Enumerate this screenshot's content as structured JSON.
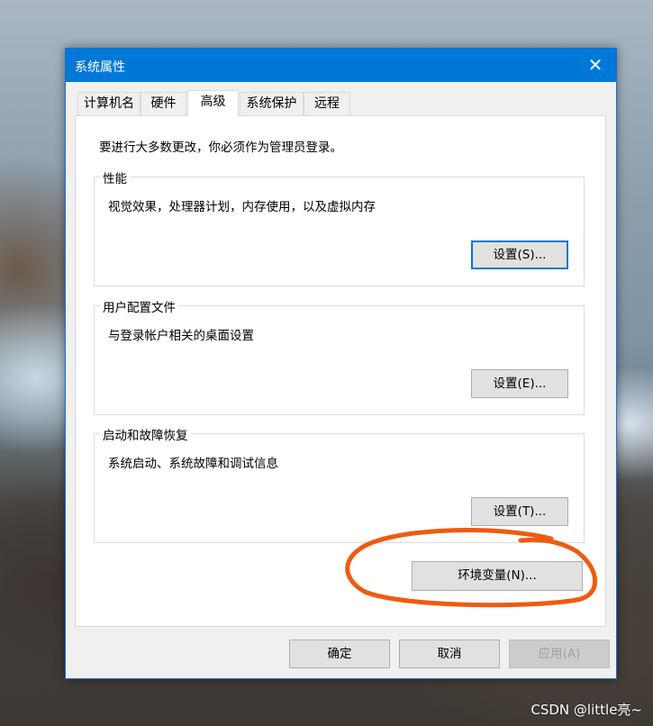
{
  "window": {
    "title": "系统属性",
    "close_glyph": "✕"
  },
  "tabs": [
    {
      "label": "计算机名"
    },
    {
      "label": "硬件"
    },
    {
      "label": "高级"
    },
    {
      "label": "系统保护"
    },
    {
      "label": "远程"
    }
  ],
  "active_tab": "高级",
  "admin_note": "要进行大多数更改，你必须作为管理员登录。",
  "groups": {
    "performance": {
      "label": "性能",
      "desc": "视觉效果，处理器计划，内存使用，以及虚拟内存",
      "button": "设置(S)..."
    },
    "user_profiles": {
      "label": "用户配置文件",
      "desc": "与登录帐户相关的桌面设置",
      "button": "设置(E)..."
    },
    "startup_recovery": {
      "label": "启动和故障恢复",
      "desc": "系统启动、系统故障和调试信息",
      "button": "设置(T)..."
    }
  },
  "env_button": "环境变量(N)...",
  "footer": {
    "ok": "确定",
    "cancel": "取消",
    "apply": "应用(A)"
  },
  "watermark": "CSDN @little亮~",
  "colors": {
    "titlebar": "#0078d7",
    "annotation": "#f05a10",
    "focus": "#0078d7"
  },
  "icons": {
    "close": "close-icon"
  }
}
